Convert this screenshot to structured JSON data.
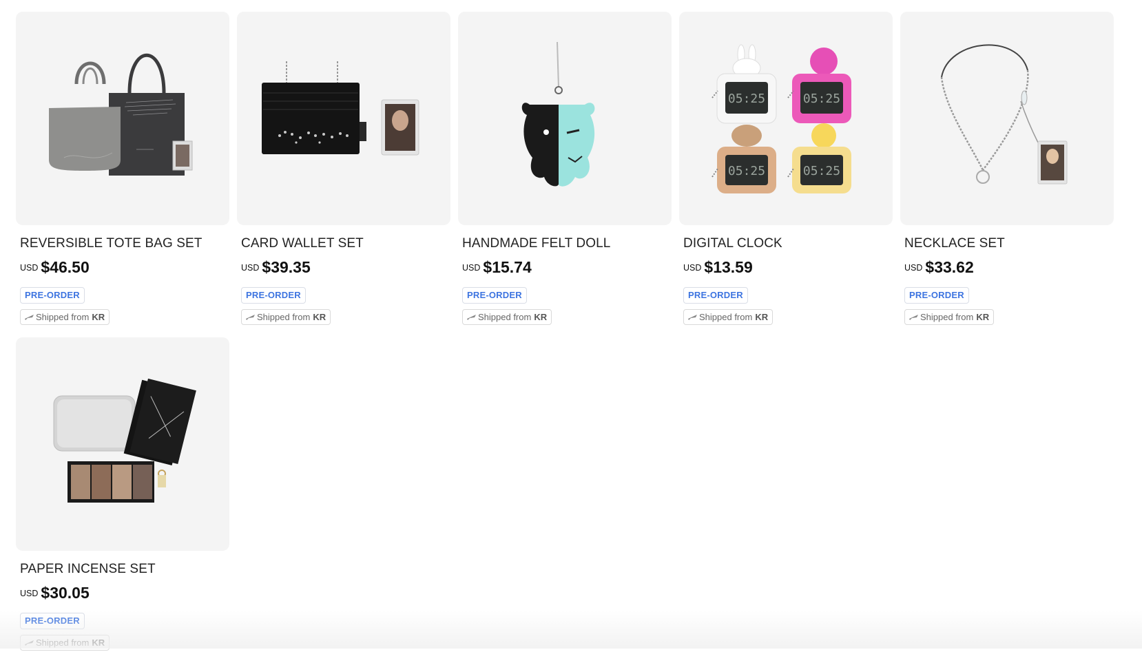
{
  "products": [
    {
      "title": "REVERSIBLE TOTE BAG SET",
      "currency": "USD",
      "price": "$46.50",
      "badge": "PRE-ORDER",
      "ship_prefix": "Shipped from",
      "ship_country": "KR",
      "image": "tote-bag-image"
    },
    {
      "title": "CARD WALLET SET",
      "currency": "USD",
      "price": "$39.35",
      "badge": "PRE-ORDER",
      "ship_prefix": "Shipped from",
      "ship_country": "KR",
      "image": "card-wallet-image"
    },
    {
      "title": "HANDMADE FELT DOLL",
      "currency": "USD",
      "price": "$15.74",
      "badge": "PRE-ORDER",
      "ship_prefix": "Shipped from",
      "ship_country": "KR",
      "image": "felt-doll-image"
    },
    {
      "title": "DIGITAL CLOCK",
      "currency": "USD",
      "price": "$13.59",
      "badge": "PRE-ORDER",
      "ship_prefix": "Shipped from",
      "ship_country": "KR",
      "image": "digital-clock-image",
      "clock_display": "05:25"
    },
    {
      "title": "NECKLACE SET",
      "currency": "USD",
      "price": "$33.62",
      "badge": "PRE-ORDER",
      "ship_prefix": "Shipped from",
      "ship_country": "KR",
      "image": "necklace-image"
    },
    {
      "title": "PAPER INCENSE SET",
      "currency": "USD",
      "price": "$30.05",
      "badge": "PRE-ORDER",
      "ship_prefix": "Shipped from",
      "ship_country": "KR",
      "image": "paper-incense-image"
    }
  ],
  "colors": {
    "thumb_bg": "#f4f4f4",
    "preorder_text": "#3d74e0",
    "badge_border": "#d9dde6"
  }
}
